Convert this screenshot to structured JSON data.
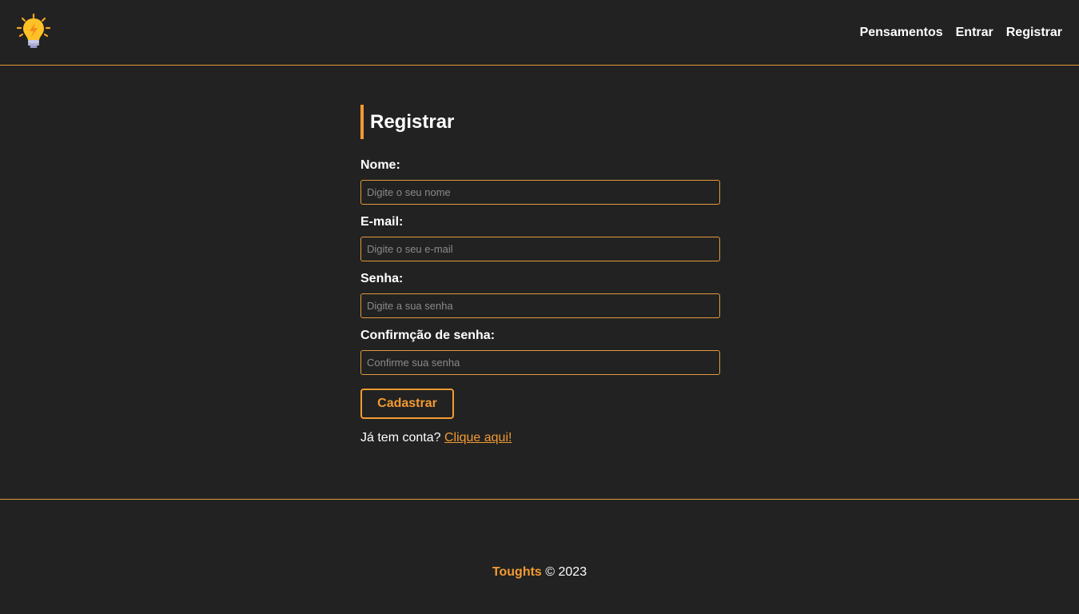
{
  "colors": {
    "background": "#222222",
    "accent": "#f29a32",
    "border": "#e09a3c",
    "text": "#ffffff",
    "placeholder": "#8a8a8a"
  },
  "navbar": {
    "logo_icon": "lightbulb-icon",
    "links": [
      {
        "label": "Pensamentos"
      },
      {
        "label": "Entrar"
      },
      {
        "label": "Registrar"
      }
    ]
  },
  "page": {
    "title": "Registrar"
  },
  "form": {
    "fields": [
      {
        "label": "Nome:",
        "placeholder": "Digite o seu nome",
        "value": ""
      },
      {
        "label": "E-mail:",
        "placeholder": "Digite o seu e-mail",
        "value": ""
      },
      {
        "label": "Senha:",
        "placeholder": "Digite a sua senha",
        "value": ""
      },
      {
        "label": "Confirmção de senha:",
        "placeholder": "Confirme sua senha",
        "value": ""
      }
    ],
    "submit_label": "Cadastrar",
    "login_prompt": "Já tem conta?",
    "login_link": "Clique aqui!"
  },
  "footer": {
    "brand": "Toughts",
    "copyright": "© 2023"
  }
}
